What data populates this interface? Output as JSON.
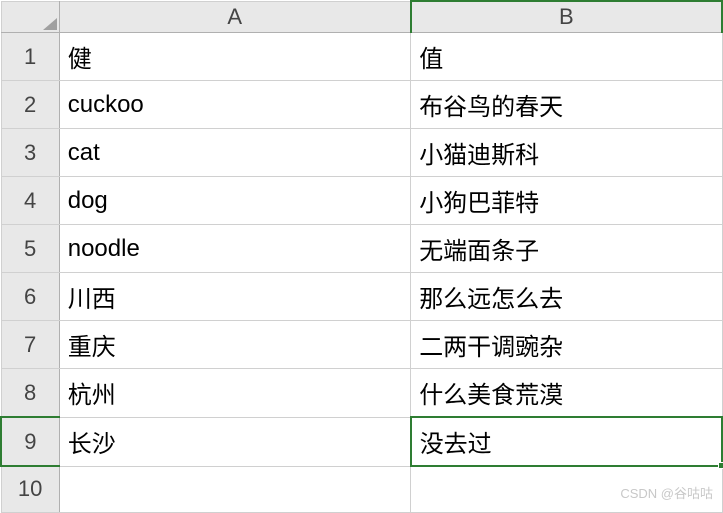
{
  "columns": [
    "A",
    "B"
  ],
  "row_headers": [
    "1",
    "2",
    "3",
    "4",
    "5",
    "6",
    "7",
    "8",
    "9",
    "10"
  ],
  "active_cell": {
    "row": 9,
    "col": "B"
  },
  "data": {
    "rows": [
      {
        "a": "健",
        "b": "值"
      },
      {
        "a": "cuckoo",
        "b": "布谷鸟的春天"
      },
      {
        "a": "cat",
        "b": "小猫迪斯科"
      },
      {
        "a": "dog",
        "b": "小狗巴菲特"
      },
      {
        "a": "noodle",
        "b": "无端面条子"
      },
      {
        "a": "川西",
        "b": "那么远怎么去"
      },
      {
        "a": "重庆",
        "b": "二两干调豌杂"
      },
      {
        "a": "杭州",
        "b": "什么美食荒漠"
      },
      {
        "a": "长沙",
        "b": "没去过"
      },
      {
        "a": "",
        "b": ""
      }
    ]
  },
  "watermark": "CSDN @谷咕咕"
}
